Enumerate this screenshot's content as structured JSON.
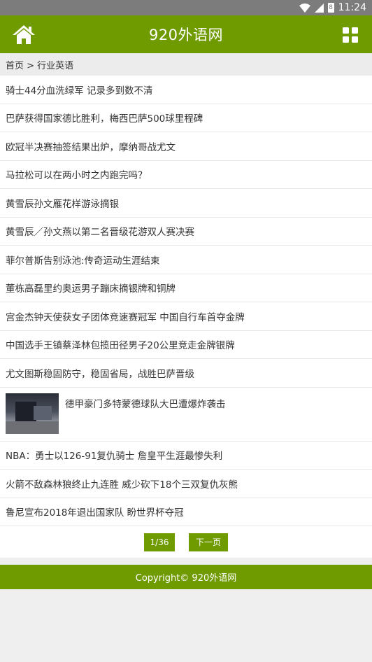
{
  "status_bar": {
    "time": "11:24",
    "battery_level": "8"
  },
  "header": {
    "title": "920外语网",
    "home_icon": "home-icon",
    "menu_icon": "grid-menu-icon"
  },
  "breadcrumb": {
    "text": "首页 > 行业英语"
  },
  "articles": [
    {
      "title": "骑士44分血洗绿军 记录多到数不清"
    },
    {
      "title": "巴萨获得国家德比胜利，梅西巴萨500球里程碑"
    },
    {
      "title": "欧冠半决赛抽签结果出炉，摩纳哥战尤文"
    },
    {
      "title": "马拉松可以在两小时之内跑完吗？"
    },
    {
      "title": "黄雪辰孙文雁花样游泳摘银"
    },
    {
      "title": "黄雪辰／孙文燕以第二名晋级花游双人赛决赛"
    },
    {
      "title": "菲尔普斯告别泳池:传奇运动生涯结束"
    },
    {
      "title": "董栋高磊里约奥运男子蹦床摘银牌和铜牌"
    },
    {
      "title": "宫金杰钟天使获女子团体竞速赛冠军 中国自行车首夺金牌"
    },
    {
      "title": "中国选手王镇蔡泽林包揽田径男子20公里竞走金牌银牌"
    },
    {
      "title": "尤文图斯稳固防守，稳固省局，战胜巴萨晋级"
    },
    {
      "title": "德甲豪门多特蒙德球队大巴遭爆炸袭击",
      "has_image": true
    },
    {
      "title": "NBA：勇士以126-91复仇骑士 詹皇平生涯最惨失利"
    },
    {
      "title": "火箭不敌森林狼终止九连胜 威少砍下18个三双复仇灰熊"
    },
    {
      "title": "鲁尼宣布2018年退出国家队 盼世界杯夺冠"
    }
  ],
  "pager": {
    "page_label": "1/36",
    "next_label": "下一页"
  },
  "footer": {
    "text": "Copyright© 920外语网"
  },
  "colors": {
    "brand": "#6f9a00",
    "status_bar": "#7c7c7c"
  }
}
